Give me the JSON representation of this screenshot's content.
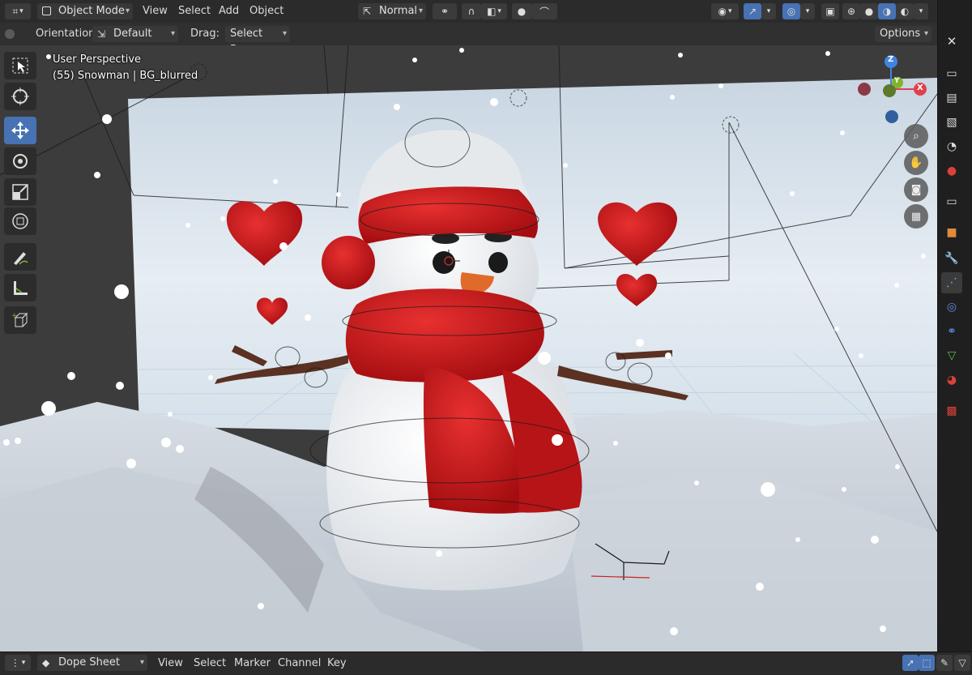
{
  "header": {
    "mode_label": "Object Mode",
    "menus": [
      "View",
      "Select",
      "Add",
      "Object"
    ],
    "transform_orientation": "Normal"
  },
  "tool_settings": {
    "orientation_label": "Orientation:",
    "orientation_value": "Default",
    "drag_label": "Drag:",
    "drag_value": "Select Box",
    "options_label": "Options"
  },
  "viewport": {
    "view_name": "User Perspective",
    "object_info": "(55) Snowman | BG_blurred",
    "gizmo_axes": {
      "z": "Z",
      "y": "Y",
      "x": "X"
    }
  },
  "toolbar": {
    "tools": [
      "select-box-icon",
      "cursor-icon",
      "move-icon",
      "rotate-icon",
      "scale-icon",
      "transform-icon",
      "annotate-icon",
      "measure-icon",
      "add-cube-icon"
    ],
    "active_tool": "move-icon"
  },
  "properties_tabs": [
    "tool-icon",
    "render-icon",
    "output-icon",
    "view-layer-icon",
    "scene-icon",
    "world-icon",
    "collection-icon",
    "object-icon",
    "modifier-icon",
    "particles-icon",
    "physics-icon",
    "constraints-icon",
    "data-icon",
    "material-icon",
    "texture-icon"
  ],
  "bottom": {
    "editor_label": "Dope Sheet",
    "menus": [
      "View",
      "Select",
      "Marker",
      "Channel",
      "Key"
    ]
  },
  "colors": {
    "accent": "#4772b3",
    "axis_x": "#e0404f",
    "axis_y": "#7fb32b",
    "axis_z": "#3f84e0"
  }
}
